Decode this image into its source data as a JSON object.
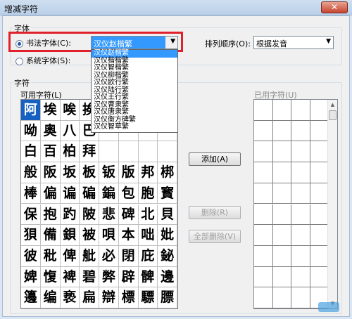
{
  "window": {
    "title": "增减字符",
    "close": "✕"
  },
  "font_section": {
    "label": "字体",
    "calligraphy_radio": "书法字体(C):",
    "system_radio": "系统字体(S):",
    "selected_font": "汉仪赵楷繁",
    "order_label": "排列顺序(O):",
    "order_value": "根据发音",
    "dropdown_options": [
      "汉仪赵楷繁",
      "汉仪楷楷繁",
      "汉仪智楷繁",
      "汉仪柳楷繁",
      "汉仪欧行繁",
      "汉仪陆行繁",
      "汉仪王行繁",
      "汉仪曹隶繁",
      "汉仪唐隶繁",
      "汉仪衡方碑繁",
      "汉仪智草繁"
    ]
  },
  "char_section": {
    "label": "字符",
    "available_label": "可用字符(L)",
    "used_label": "已用字符(U)",
    "rows": [
      [
        "阿",
        "埃",
        "唉",
        "挨",
        "",
        "",
        "",
        ""
      ],
      [
        "呦",
        "奥",
        "八",
        "巴",
        "",
        "",
        "",
        ""
      ],
      [
        "白",
        "百",
        "柏",
        "拜",
        "",
        "",
        "",
        ""
      ],
      [
        "般",
        "阪",
        "坂",
        "板",
        "钣",
        "版",
        "邦",
        "梆"
      ],
      [
        "棒",
        "偏",
        "谝",
        "碥",
        "鍽",
        "包",
        "胞",
        "寳"
      ],
      [
        "保",
        "抱",
        "趵",
        "陂",
        "悲",
        "碑",
        "北",
        "貝"
      ],
      [
        "狽",
        "備",
        "鋇",
        "被",
        "唄",
        "本",
        "咄",
        "妣"
      ],
      [
        "彼",
        "秕",
        "俾",
        "舭",
        "必",
        "閉",
        "庇",
        "鉍"
      ],
      [
        "婢",
        "愎",
        "裨",
        "碧",
        "弊",
        "辟",
        "髀",
        "邊"
      ],
      [
        "籩",
        "编",
        "亵",
        "扁",
        "辯",
        "標",
        "驃",
        "膘"
      ]
    ]
  },
  "buttons": {
    "add": "添加(A)",
    "delete": "删除(R)",
    "delete_all": "全部删除(V)"
  }
}
